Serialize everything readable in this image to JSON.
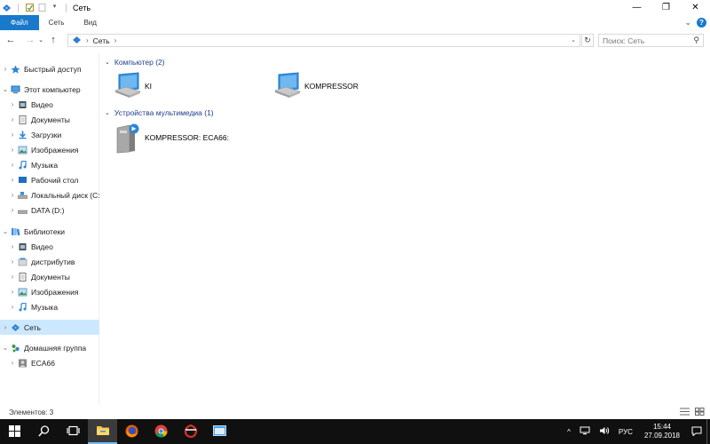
{
  "window": {
    "title": "Сеть",
    "controls": {
      "minimize": "—",
      "restore": "❐",
      "close": "✕"
    }
  },
  "ribbon": {
    "tabs": [
      {
        "label": "Файл"
      },
      {
        "label": "Сеть"
      },
      {
        "label": "Вид"
      }
    ]
  },
  "address": {
    "segments": [
      "Сеть"
    ],
    "search_placeholder": "Поиск: Сеть"
  },
  "nav": {
    "items": [
      {
        "label": "Быстрый доступ",
        "icon": "star-icon"
      },
      {
        "label": "Этот компьютер",
        "icon": "computer-icon"
      },
      {
        "label": "Видео",
        "icon": "video-icon"
      },
      {
        "label": "Документы",
        "icon": "document-icon"
      },
      {
        "label": "Загрузки",
        "icon": "download-icon"
      },
      {
        "label": "Изображения",
        "icon": "image-icon"
      },
      {
        "label": "Музыка",
        "icon": "music-icon"
      },
      {
        "label": "Рабочий стол",
        "icon": "desktop-icon"
      },
      {
        "label": "Локальный диск (С:",
        "icon": "drive-icon"
      },
      {
        "label": "DATA (D:)",
        "icon": "drive-icon"
      },
      {
        "label": "Библиотеки",
        "icon": "library-icon"
      },
      {
        "label": "Видео",
        "icon": "video-icon"
      },
      {
        "label": "дистрибутив",
        "icon": "library-icon"
      },
      {
        "label": "Документы",
        "icon": "document-icon"
      },
      {
        "label": "Изображения",
        "icon": "image-icon"
      },
      {
        "label": "Музыка",
        "icon": "music-icon"
      },
      {
        "label": "Сеть",
        "icon": "network-icon"
      },
      {
        "label": "Домашняя группа",
        "icon": "homegroup-icon"
      },
      {
        "label": "ECA66",
        "icon": "user-icon"
      }
    ]
  },
  "content": {
    "groups": [
      {
        "title": "Компьютер (2)"
      },
      {
        "title": "Устройства мультимедиа (1)"
      }
    ],
    "items": [
      {
        "label": "KI",
        "icon": "computer-icon"
      },
      {
        "label": "KOMPRESSOR",
        "icon": "computer-icon"
      },
      {
        "label": "KOMPRESSOR: ECA66:",
        "icon": "media-device-icon"
      }
    ]
  },
  "status": {
    "text": "Элементов: 3"
  },
  "taskbar": {
    "language": "РУС",
    "time": "15:44",
    "date": "27.09.2018"
  },
  "colors": {
    "accent": "#1979ca",
    "selection": "#cce8ff",
    "taskbar": "#101010"
  }
}
